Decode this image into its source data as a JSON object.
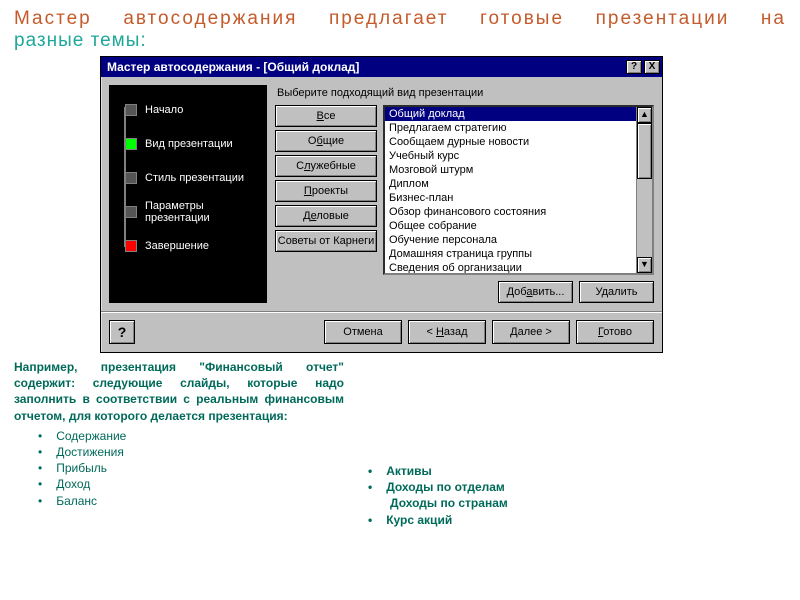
{
  "heading": {
    "line1": "Мастер автосодержания предлагает готовые презентации на",
    "line2": "разные темы:"
  },
  "dialog": {
    "title": "Мастер автосодержания - [Общий доклад]",
    "helpGlyph": "?",
    "closeGlyph": "X",
    "steps": [
      {
        "label": "Начало",
        "color": "gray"
      },
      {
        "label": "Вид презентации",
        "color": "green"
      },
      {
        "label": "Стиль презентации",
        "color": "gray"
      },
      {
        "label": "Параметры презентации",
        "color": "gray"
      },
      {
        "label": "Завершение",
        "color": "red"
      }
    ],
    "instruction": "Выберите подходящий вид презентации",
    "category_buttons": {
      "all": "Все",
      "general": "Общие",
      "service": "Служебные",
      "projects": "Проекты",
      "business": "Деловые",
      "carnegie": "Советы от Карнеги"
    },
    "presentations": [
      "Общий доклад",
      "Предлагаем стратегию",
      "Сообщаем дурные новости",
      "Учебный курс",
      "Мозговой штурм",
      "Диплом",
      "Бизнес-план",
      "Обзор финансового состояния",
      "Общее собрание",
      "Обучение персонала",
      "Домашняя страница группы",
      "Сведения об организации"
    ],
    "selected_index": 0,
    "list_add": "Добавить...",
    "list_remove": "Удалить",
    "footer": {
      "helpGlyph": "?",
      "cancel": "Отмена",
      "back": "< Назад",
      "next": "Далее >",
      "finish": "Готово"
    }
  },
  "description": {
    "intro": "Например, презентация \"Финансовый отчет\" содержит: следующие слайды, которые надо заполнить в соответствии с реальным финансовым отчетом, для которого делается презентация:",
    "left_items": [
      "Содержание",
      "Достижения",
      "Прибыль",
      "Доход",
      "Баланс"
    ],
    "right_items": [
      "Активы",
      "Доходы по отделам",
      "Доходы по странам",
      "Курс акций"
    ]
  }
}
